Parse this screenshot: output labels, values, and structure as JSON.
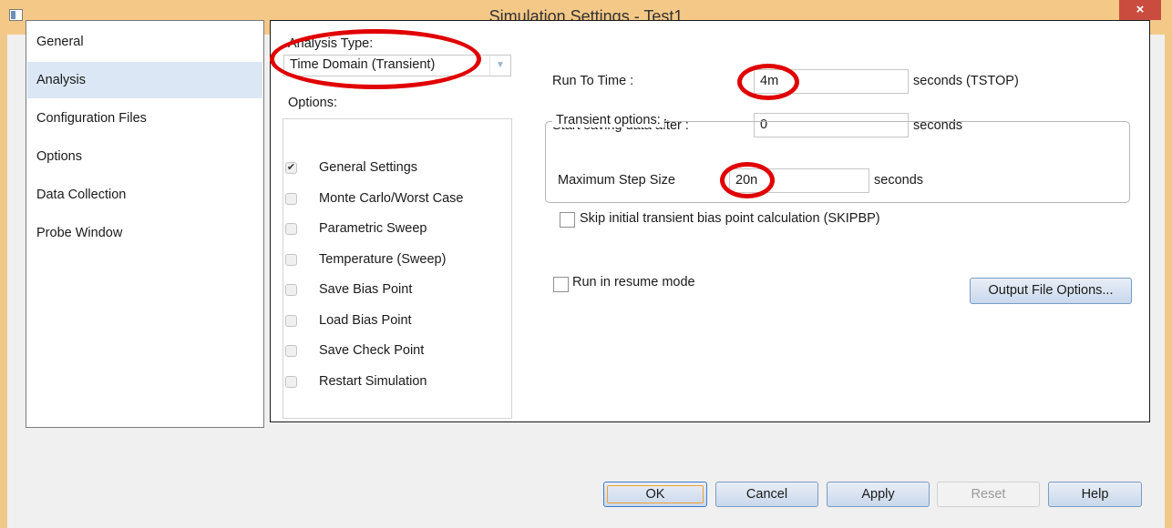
{
  "window": {
    "title": "Simulation Settings - Test1",
    "close_glyph": "×"
  },
  "nav": {
    "items": [
      "General",
      "Analysis",
      "Configuration Files",
      "Options",
      "Data Collection",
      "Probe Window"
    ],
    "selected": "Analysis"
  },
  "analysis": {
    "type_label": "Analysis Type:",
    "type_value": "Time Domain (Transient)",
    "options_label": "Options:",
    "options": [
      {
        "label": "General Settings",
        "checked": true
      },
      {
        "label": "Monte Carlo/Worst Case",
        "checked": false
      },
      {
        "label": "Parametric Sweep",
        "checked": false
      },
      {
        "label": "Temperature (Sweep)",
        "checked": false
      },
      {
        "label": "Save Bias Point",
        "checked": false
      },
      {
        "label": "Load Bias Point",
        "checked": false
      },
      {
        "label": "Save Check Point",
        "checked": false
      },
      {
        "label": "Restart Simulation",
        "checked": false
      }
    ]
  },
  "fields": {
    "run_to_time_label": "Run To Time :",
    "run_to_time_value": "4m",
    "run_to_time_unit": "seconds (TSTOP)",
    "start_saving_label": "Start saving data after :",
    "start_saving_value": "0",
    "start_saving_unit": "seconds"
  },
  "transient": {
    "group_label": "Transient options:",
    "max_step_label": "Maximum Step Size",
    "max_step_value": "20n",
    "max_step_unit": "seconds",
    "skip_bias_label": "Skip initial transient bias point calculation (SKIPBP)"
  },
  "resume_label": "Run in resume mode",
  "buttons": {
    "output_file_options": "Output File Options...",
    "ok": "OK",
    "cancel": "Cancel",
    "apply": "Apply",
    "reset": "Reset",
    "help": "Help"
  },
  "colors": {
    "title_bar": "#f4c887",
    "close_button": "#c94c3f",
    "selected_nav": "#dbe7f5",
    "annotation": "#e00000"
  },
  "icons": {
    "window": "window-icon",
    "combo_arrow": "chevron-down-icon",
    "check": "check-icon"
  }
}
